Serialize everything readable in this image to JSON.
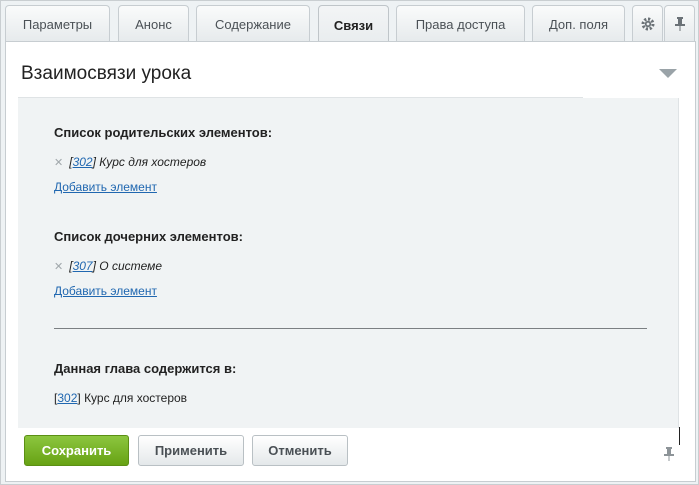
{
  "tabs": [
    {
      "label": "Параметры"
    },
    {
      "label": "Анонс"
    },
    {
      "label": "Содержание"
    },
    {
      "label": "Связи",
      "active": true
    },
    {
      "label": "Права доступа"
    },
    {
      "label": "Доп. поля"
    }
  ],
  "tab_icons": {
    "settings": "gear-icon",
    "pin": "pin-icon"
  },
  "section": {
    "title": "Взаимосвязи урока"
  },
  "parents": {
    "title": "Список родительских элементов:",
    "items": [
      {
        "id": "302",
        "name": "Курс для хостеров"
      }
    ],
    "add_label": "Добавить элемент"
  },
  "children": {
    "title": "Список дочерних элементов:",
    "items": [
      {
        "id": "307",
        "name": "О системе"
      }
    ],
    "add_label": "Добавить элемент"
  },
  "contains": {
    "title": "Данная глава содержится в:",
    "id": "302",
    "name": "Курс для хостеров"
  },
  "buttons": {
    "save": "Сохранить",
    "apply": "Применить",
    "cancel": "Отменить"
  },
  "colors": {
    "accent_green": "#7ab32a",
    "link_blue": "#2067b0"
  }
}
